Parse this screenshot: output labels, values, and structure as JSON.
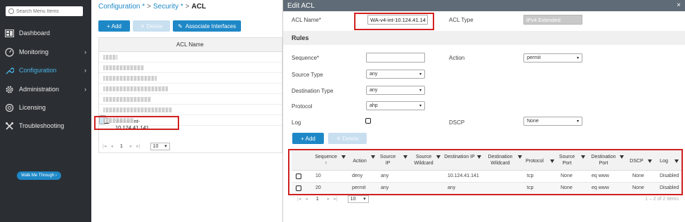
{
  "sidebar": {
    "search_placeholder": "Search Menu Items",
    "items": [
      {
        "label": "Dashboard",
        "icon": "dashboard-icon",
        "chevron": ""
      },
      {
        "label": "Monitoring",
        "icon": "monitoring-icon",
        "chevron": "›"
      },
      {
        "label": "Configuration",
        "icon": "wrench-icon",
        "chevron": "›"
      },
      {
        "label": "Administration",
        "icon": "gear-icon",
        "chevron": "›"
      },
      {
        "label": "Licensing",
        "icon": "license-icon",
        "chevron": ""
      },
      {
        "label": "Troubleshooting",
        "icon": "tools-icon",
        "chevron": ""
      }
    ],
    "walk_me": "Walk Me Through ›",
    "accent": "#49b4e8"
  },
  "breadcrumb": {
    "item1": "Configuration *",
    "sep": ">",
    "item2": "Security *",
    "current": "ACL"
  },
  "toolbar": {
    "add": "+ Add",
    "delete": "✕ Delete",
    "associate": "Associate Interfaces"
  },
  "acl_grid": {
    "header": "ACL Name",
    "selected_row": "WA-v4-int-10.124.41.141",
    "page": "1",
    "page_size": "10"
  },
  "modal": {
    "title": "Edit ACL",
    "close": "×",
    "acl_name_label": "ACL Name*",
    "acl_name_value": "WA-v4-int-10.124.41.14",
    "acl_type_label": "ACL Type",
    "acl_type_value": "IPv4 Extended",
    "rules_heading": "Rules",
    "sequence_label": "Sequence*",
    "action_label": "Action",
    "action_value": "permit",
    "source_type_label": "Source Type",
    "source_type_value": "any",
    "dest_type_label": "Destination Type",
    "dest_type_value": "any",
    "protocol_label": "Protocol",
    "protocol_value": "ahp",
    "log_label": "Log",
    "dscp_label": "DSCP",
    "dscp_value": "None",
    "add": "+ Add",
    "delete": "✕ Delete"
  },
  "rules_table": {
    "headers": [
      "Sequence ↑",
      "Action",
      "Source IP",
      "Source Wildcard",
      "Destination IP",
      "Destination Wildcard",
      "Protocol",
      "Source Port",
      "Destination Port",
      "DSCP",
      "Log"
    ],
    "rows": [
      [
        "10",
        "deny",
        "any",
        "",
        "10.124.41.141",
        "",
        "tcp",
        "None",
        "eq www",
        "None",
        "Disabled"
      ],
      [
        "20",
        "permit",
        "any",
        "",
        "any",
        "",
        "tcp",
        "None",
        "eq www",
        "None",
        "Disabled"
      ]
    ],
    "page": "1",
    "page_size": "10",
    "summary": "1 – 2 of 2 items"
  }
}
